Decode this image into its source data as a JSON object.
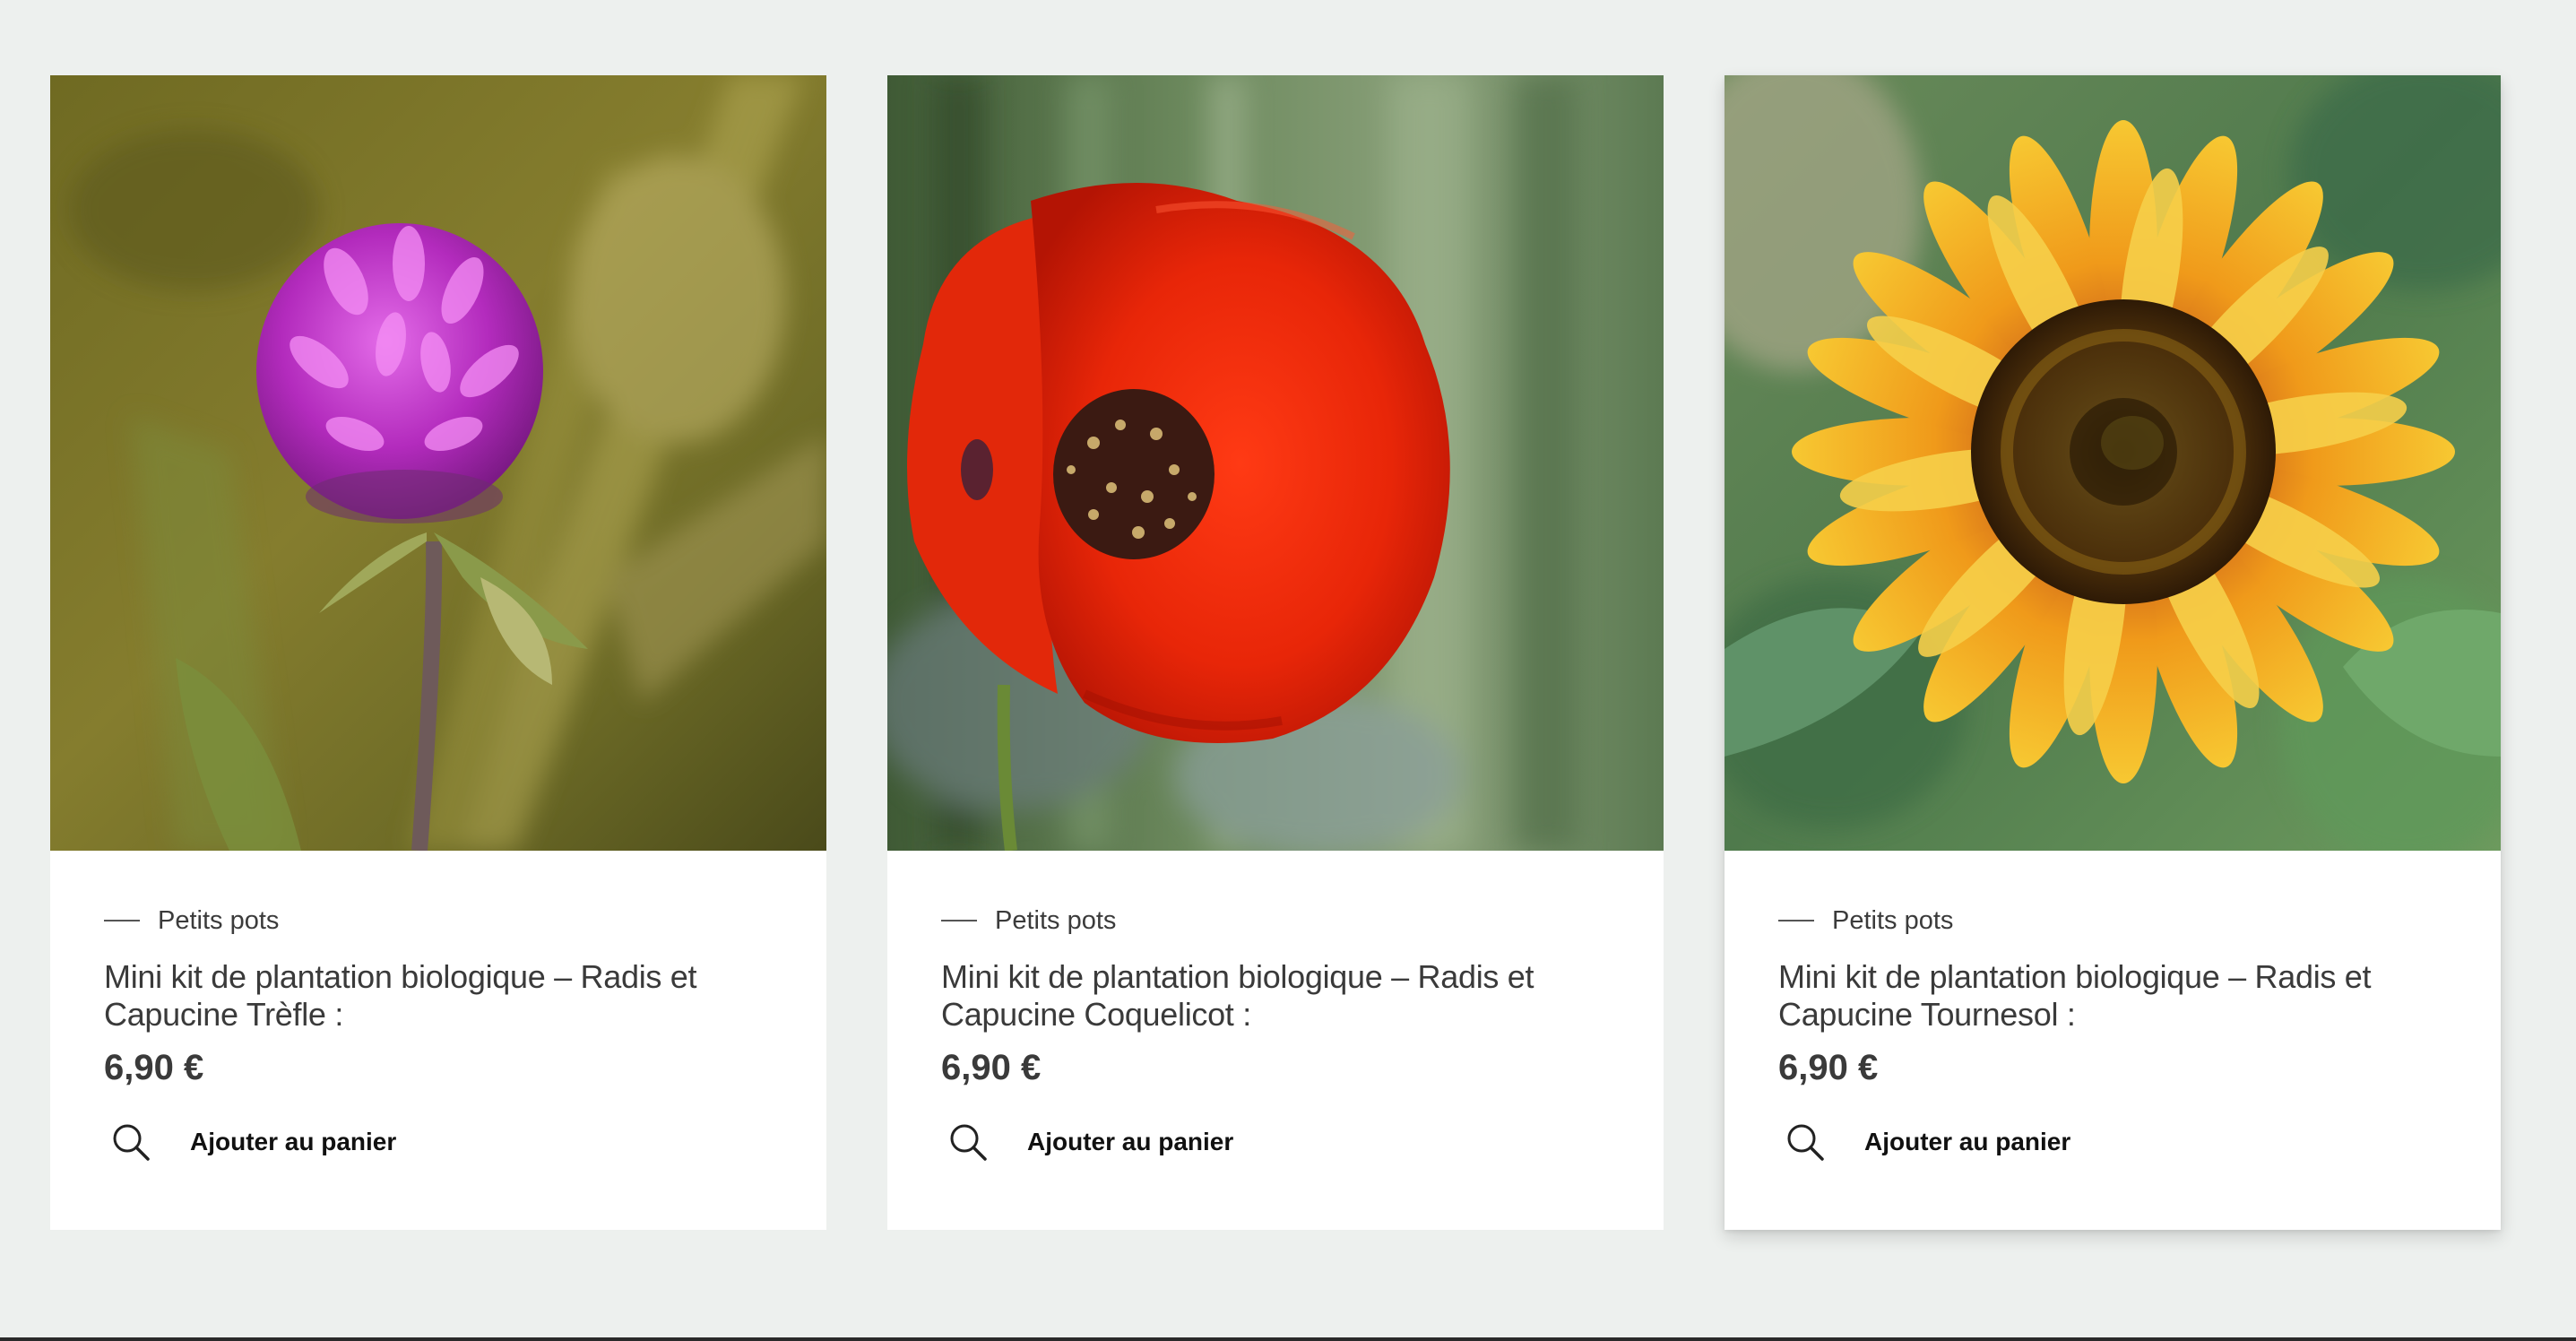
{
  "products": [
    {
      "image_alt": "",
      "category": "Petits pots",
      "title": "Mini kit de plantation biologique – Radis et Capucine Trèfle :",
      "price": "6,90 €",
      "add_label": "Ajouter au panier",
      "icon": "search-icon"
    },
    {
      "image_alt": "",
      "category": "Petits pots",
      "title": "Mini kit de plantation biologique – Radis et Capucine Coquelicot :",
      "price": "6,90 €",
      "add_label": "Ajouter au panier",
      "icon": "search-icon"
    },
    {
      "image_alt": "",
      "category": "Petits pots",
      "title": "Mini kit de plantation biologique – Radis et Capucine Tournesol :",
      "price": "6,90 €",
      "add_label": "Ajouter au panier",
      "icon": "search-icon"
    }
  ],
  "colors": {
    "page_background": "#edf0ee",
    "card_background": "#ffffff",
    "text": "#3a3a3a"
  }
}
